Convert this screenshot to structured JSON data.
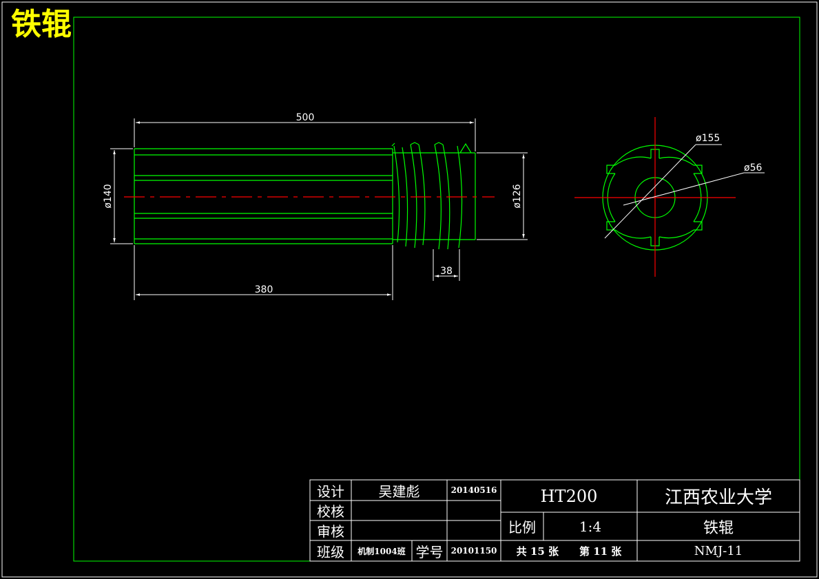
{
  "stamp": "铁辊",
  "dimensions": {
    "length_total": "500",
    "length_body": "380",
    "pitch": "38",
    "dia_body": "ø140",
    "dia_end": "ø126",
    "dia_outer": "ø155",
    "dia_bore": "ø56"
  },
  "title_block": {
    "design_label": "设计",
    "designer": "吴建彪",
    "design_date": "20140516",
    "check_label": "校核",
    "review_label": "审核",
    "class_label": "班级",
    "class_value": "机制1004班",
    "student_no_label": "学号",
    "student_no": "20101150",
    "material": "HT200",
    "school": "江西农业大学",
    "scale_label": "比例",
    "scale_value": "1:4",
    "part_name": "铁辊",
    "sheets": "共 15 张　　第 11 张",
    "drawing_no": "NMJ-11"
  },
  "colors": {
    "background": "#000000",
    "outline": "#00ff00",
    "centerline": "#ff0000",
    "dimension": "#ffffff",
    "stamp": "#ffff00"
  }
}
